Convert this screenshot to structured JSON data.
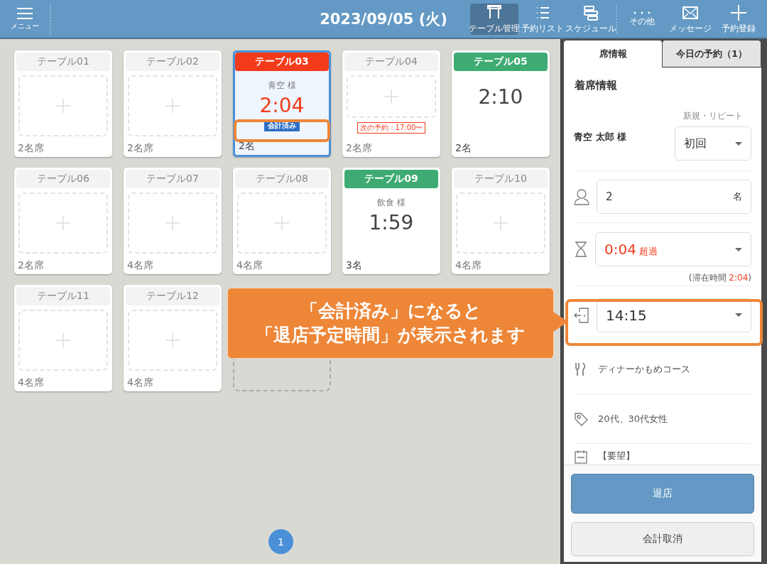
{
  "header": {
    "menu_label": "メニュー",
    "date": "2023/09/05 (火)",
    "toolbar": [
      {
        "kind": "table",
        "label": "テーブル管理",
        "selected": true
      },
      {
        "kind": "list",
        "label": "予約リスト",
        "selected": false
      },
      {
        "kind": "schedule",
        "label": "スケジュール",
        "selected": false
      },
      {
        "kind": "more",
        "label": "その他",
        "selected": false
      },
      {
        "kind": "mail",
        "label": "メッセージ",
        "selected": false
      },
      {
        "kind": "add",
        "label": "予約登録",
        "selected": false
      }
    ]
  },
  "tables": [
    {
      "kind": "empty",
      "name": "テーブル01",
      "seats": "2名席",
      "selected": false
    },
    {
      "kind": "empty",
      "name": "テーブル02",
      "seats": "2名席",
      "selected": false
    },
    {
      "kind": "occupied",
      "name": "テーブル03",
      "color": "#f23b1b",
      "guest": "青空 様",
      "time": "2:04",
      "overdue": true,
      "badge": "会計済み",
      "seats": "2名",
      "selected": true
    },
    {
      "kind": "empty",
      "name": "テーブル04",
      "next_reservation": "次の予約：17:00〜",
      "seats": "2名席",
      "selected": false
    },
    {
      "kind": "occupied",
      "name": "テーブル05",
      "color": "#3dab72",
      "time": "2:10",
      "overdue": false,
      "seats": "2名",
      "selected": false
    },
    {
      "kind": "empty",
      "name": "テーブル06",
      "seats": "2名席",
      "selected": false
    },
    {
      "kind": "empty",
      "name": "テーブル07",
      "seats": "4名席",
      "selected": false
    },
    {
      "kind": "empty",
      "name": "テーブル08",
      "seats": "4名席",
      "selected": false
    },
    {
      "kind": "occupied",
      "name": "テーブル09",
      "color": "#3dab72",
      "guest": "飲食 様",
      "time": "1:59",
      "overdue": false,
      "seats": "3名",
      "selected": false
    },
    {
      "kind": "empty",
      "name": "テーブル10",
      "seats": "4名席",
      "selected": false
    },
    {
      "kind": "empty",
      "name": "テーブル11",
      "seats": "4名席",
      "selected": false
    },
    {
      "kind": "empty",
      "name": "テーブル12",
      "seats": "4名席",
      "selected": false
    },
    {
      "kind": "add"
    }
  ],
  "pagination": [
    {
      "label": "1",
      "selected": true
    }
  ],
  "callout": {
    "lines": [
      "「会計済み」になると",
      "「退店予定時間」が表示されます"
    ]
  },
  "panel": {
    "tabs": [
      {
        "label": "席情報",
        "selected": true
      },
      {
        "label": "今日の予約（1）",
        "selected": false
      }
    ],
    "section_title": "着席情報",
    "guest_name": "青空 太郎 様",
    "repeat_label": "新規・リピート",
    "repeat_value": "初回",
    "people": "2",
    "people_unit": "名",
    "elapsed": "0:04",
    "elapsed_note": "超過",
    "stay": {
      "label": "(滞在時間 ",
      "time": "2:04",
      "close": ")"
    },
    "exit_time": "14:15",
    "course": "ディナーかもめコース",
    "tags": "20代、30代女性",
    "request": "【要望】",
    "buttons": [
      {
        "kind": "primary",
        "label": "退店"
      },
      {
        "kind": "secondary",
        "label": "会計取消"
      }
    ]
  }
}
